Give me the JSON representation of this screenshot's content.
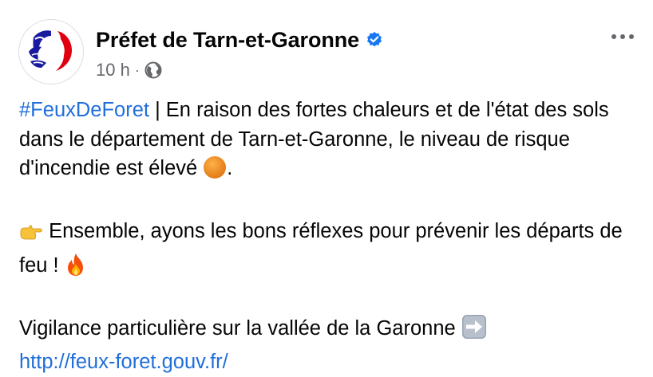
{
  "post": {
    "author_name": "Préfet de Tarn-et-Garonne",
    "timestamp": "10 h",
    "separator": "·",
    "hashtag": "#FeuxDeForet",
    "line1_rest": " | En raison des fortes chaleurs et de l'état des sols dans le département de Tarn-et-Garonne, le niveau de risque d'incendie est élevé ",
    "line1_end": ".",
    "line2": " Ensemble, ayons les bons réflexes pour prévenir les départs de feu ! ",
    "line3": "Vigilance particulière sur la vallée de la Garonne ",
    "link": "http://feux-foret.gouv.fr/"
  },
  "icons": {
    "verified": "verified-badge-icon",
    "globe": "globe-icon",
    "more": "more-options-icon",
    "orange_circle": "orange-circle-emoji",
    "pointing_hand": "pointing-right-hand-emoji",
    "fire": "fire-emoji",
    "arrow": "right-arrow-emoji"
  },
  "colors": {
    "link": "#216fdb",
    "verified": "#1877f2",
    "meta": "#65676b",
    "text": "#050505"
  }
}
